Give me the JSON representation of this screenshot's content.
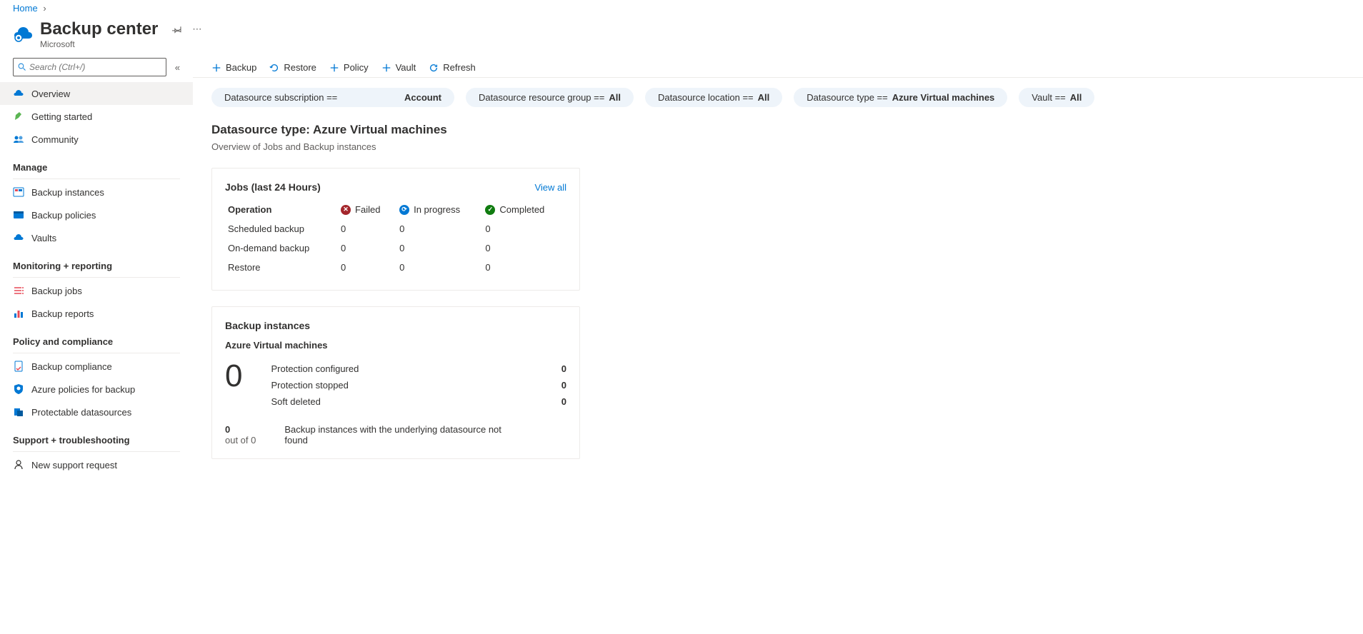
{
  "breadcrumb": {
    "home": "Home"
  },
  "header": {
    "title": "Backup center",
    "subtitle": "Microsoft"
  },
  "search": {
    "placeholder": "Search (Ctrl+/)"
  },
  "sidebar": {
    "overview": "Overview",
    "getting_started": "Getting started",
    "community": "Community",
    "section_manage": "Manage",
    "backup_instances": "Backup instances",
    "backup_policies": "Backup policies",
    "vaults": "Vaults",
    "section_monitoring": "Monitoring + reporting",
    "backup_jobs": "Backup jobs",
    "backup_reports": "Backup reports",
    "section_policy": "Policy and compliance",
    "backup_compliance": "Backup compliance",
    "azure_policies": "Azure policies for backup",
    "protectable": "Protectable datasources",
    "section_support": "Support + troubleshooting",
    "new_support": "New support request"
  },
  "toolbar": {
    "backup": "Backup",
    "restore": "Restore",
    "policy": "Policy",
    "vault": "Vault",
    "refresh": "Refresh"
  },
  "filters": {
    "sub_label": "Datasource subscription ==",
    "sub_value": "Account",
    "rg_label": "Datasource resource group == ",
    "rg_value": "All",
    "loc_label": "Datasource location == ",
    "loc_value": "All",
    "type_label": "Datasource type == ",
    "type_value": "Azure Virtual machines",
    "vault_label": "Vault == ",
    "vault_value": "All"
  },
  "content": {
    "title": "Datasource type: Azure Virtual machines",
    "subtitle": "Overview of Jobs and Backup instances"
  },
  "jobs": {
    "title": "Jobs (last 24 Hours)",
    "view_all": "View all",
    "col_operation": "Operation",
    "col_failed": "Failed",
    "col_inprogress": "In progress",
    "col_completed": "Completed",
    "rows": {
      "r0": {
        "op": "Scheduled backup",
        "failed": "0",
        "inprog": "0",
        "comp": "0"
      },
      "r1": {
        "op": "On-demand backup",
        "failed": "0",
        "inprog": "0",
        "comp": "0"
      },
      "r2": {
        "op": "Restore",
        "failed": "0",
        "inprog": "0",
        "comp": "0"
      }
    }
  },
  "bi": {
    "title": "Backup instances",
    "subtitle": "Azure Virtual machines",
    "big": "0",
    "stats": {
      "s0": {
        "label": "Protection configured",
        "value": "0"
      },
      "s1": {
        "label": "Protection stopped",
        "value": "0"
      },
      "s2": {
        "label": "Soft deleted",
        "value": "0"
      }
    },
    "foot_count": "0",
    "foot_out": "out of 0",
    "foot_text": "Backup instances with the underlying datasource not found"
  }
}
